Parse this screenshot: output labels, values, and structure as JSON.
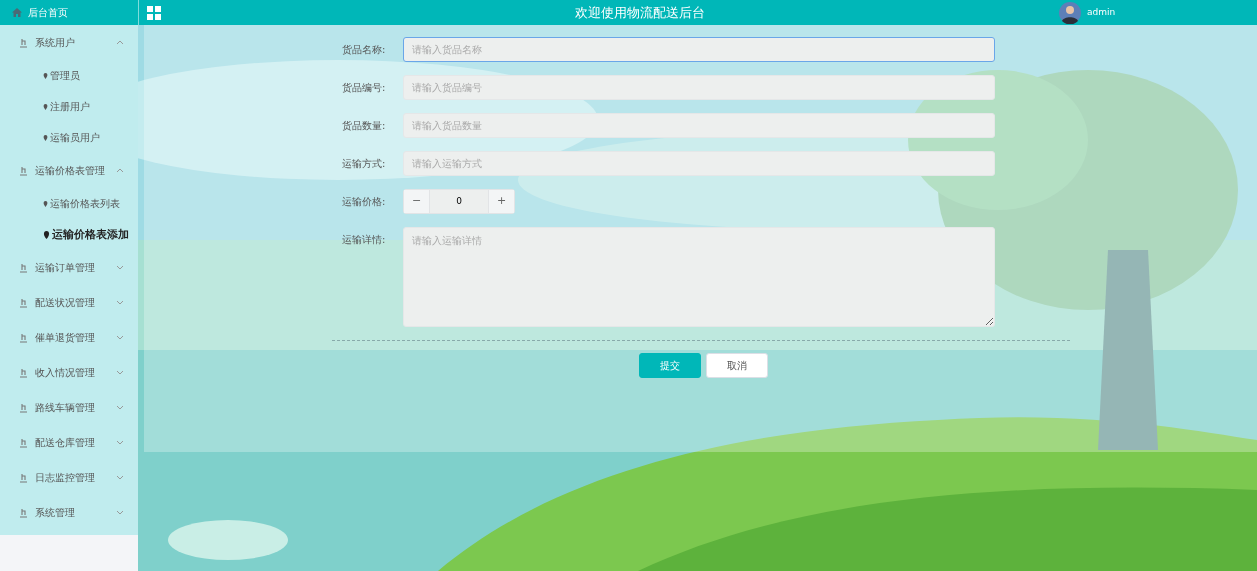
{
  "sidebar": {
    "home": "后台首页",
    "groups": [
      {
        "label": "系统用户",
        "expanded": true,
        "children": [
          {
            "label": "管理员",
            "selected": false
          },
          {
            "label": "注册用户",
            "selected": false
          },
          {
            "label": "运输员用户",
            "selected": false
          }
        ]
      },
      {
        "label": "运输价格表管理",
        "expanded": true,
        "children": [
          {
            "label": "运输价格表列表",
            "selected": false
          },
          {
            "label": "运输价格表添加",
            "selected": true
          }
        ]
      },
      {
        "label": "运输订单管理",
        "expanded": false
      },
      {
        "label": "配送状况管理",
        "expanded": false
      },
      {
        "label": "催单退货管理",
        "expanded": false
      },
      {
        "label": "收入情况管理",
        "expanded": false
      },
      {
        "label": "路线车辆管理",
        "expanded": false
      },
      {
        "label": "配送仓库管理",
        "expanded": false
      },
      {
        "label": "日志监控管理",
        "expanded": false
      },
      {
        "label": "系统管理",
        "expanded": false
      }
    ]
  },
  "topbar": {
    "title": "欢迎使用物流配送后台",
    "user": "admin"
  },
  "form": {
    "fields": [
      {
        "kind": "text",
        "label": "货品名称:",
        "placeholder": "请输入货品名称",
        "focused": true
      },
      {
        "kind": "text",
        "label": "货品编号:",
        "placeholder": "请输入货品编号",
        "focused": false
      },
      {
        "kind": "text",
        "label": "货品数量:",
        "placeholder": "请输入货品数量",
        "focused": false
      },
      {
        "kind": "text",
        "label": "运输方式:",
        "placeholder": "请输入运输方式",
        "focused": false
      },
      {
        "kind": "number",
        "label": "运输价格:",
        "value": "0",
        "minus": "−",
        "plus": "+"
      },
      {
        "kind": "textarea",
        "label": "运输详情:",
        "placeholder": "请输入运输详情",
        "focused": false
      }
    ],
    "buttons": [
      {
        "kind": "primary",
        "label": "提交"
      },
      {
        "kind": "default",
        "label": "取消"
      }
    ]
  }
}
